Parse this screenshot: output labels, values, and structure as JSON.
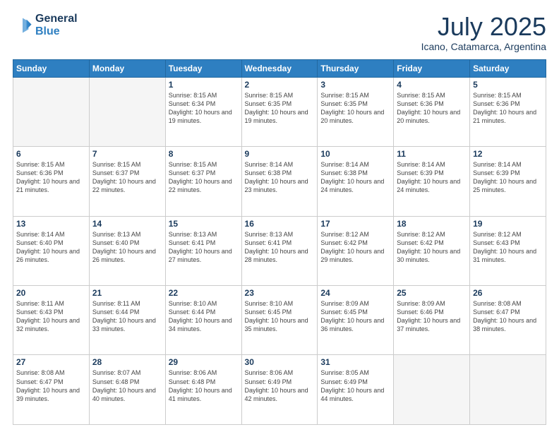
{
  "header": {
    "logo_line1": "General",
    "logo_line2": "Blue",
    "month_title": "July 2025",
    "location": "Icano, Catamarca, Argentina"
  },
  "days_of_week": [
    "Sunday",
    "Monday",
    "Tuesday",
    "Wednesday",
    "Thursday",
    "Friday",
    "Saturday"
  ],
  "weeks": [
    [
      {
        "day": "",
        "info": ""
      },
      {
        "day": "",
        "info": ""
      },
      {
        "day": "1",
        "info": "Sunrise: 8:15 AM\nSunset: 6:34 PM\nDaylight: 10 hours and 19 minutes."
      },
      {
        "day": "2",
        "info": "Sunrise: 8:15 AM\nSunset: 6:35 PM\nDaylight: 10 hours and 19 minutes."
      },
      {
        "day": "3",
        "info": "Sunrise: 8:15 AM\nSunset: 6:35 PM\nDaylight: 10 hours and 20 minutes."
      },
      {
        "day": "4",
        "info": "Sunrise: 8:15 AM\nSunset: 6:36 PM\nDaylight: 10 hours and 20 minutes."
      },
      {
        "day": "5",
        "info": "Sunrise: 8:15 AM\nSunset: 6:36 PM\nDaylight: 10 hours and 21 minutes."
      }
    ],
    [
      {
        "day": "6",
        "info": "Sunrise: 8:15 AM\nSunset: 6:36 PM\nDaylight: 10 hours and 21 minutes."
      },
      {
        "day": "7",
        "info": "Sunrise: 8:15 AM\nSunset: 6:37 PM\nDaylight: 10 hours and 22 minutes."
      },
      {
        "day": "8",
        "info": "Sunrise: 8:15 AM\nSunset: 6:37 PM\nDaylight: 10 hours and 22 minutes."
      },
      {
        "day": "9",
        "info": "Sunrise: 8:14 AM\nSunset: 6:38 PM\nDaylight: 10 hours and 23 minutes."
      },
      {
        "day": "10",
        "info": "Sunrise: 8:14 AM\nSunset: 6:38 PM\nDaylight: 10 hours and 24 minutes."
      },
      {
        "day": "11",
        "info": "Sunrise: 8:14 AM\nSunset: 6:39 PM\nDaylight: 10 hours and 24 minutes."
      },
      {
        "day": "12",
        "info": "Sunrise: 8:14 AM\nSunset: 6:39 PM\nDaylight: 10 hours and 25 minutes."
      }
    ],
    [
      {
        "day": "13",
        "info": "Sunrise: 8:14 AM\nSunset: 6:40 PM\nDaylight: 10 hours and 26 minutes."
      },
      {
        "day": "14",
        "info": "Sunrise: 8:13 AM\nSunset: 6:40 PM\nDaylight: 10 hours and 26 minutes."
      },
      {
        "day": "15",
        "info": "Sunrise: 8:13 AM\nSunset: 6:41 PM\nDaylight: 10 hours and 27 minutes."
      },
      {
        "day": "16",
        "info": "Sunrise: 8:13 AM\nSunset: 6:41 PM\nDaylight: 10 hours and 28 minutes."
      },
      {
        "day": "17",
        "info": "Sunrise: 8:12 AM\nSunset: 6:42 PM\nDaylight: 10 hours and 29 minutes."
      },
      {
        "day": "18",
        "info": "Sunrise: 8:12 AM\nSunset: 6:42 PM\nDaylight: 10 hours and 30 minutes."
      },
      {
        "day": "19",
        "info": "Sunrise: 8:12 AM\nSunset: 6:43 PM\nDaylight: 10 hours and 31 minutes."
      }
    ],
    [
      {
        "day": "20",
        "info": "Sunrise: 8:11 AM\nSunset: 6:43 PM\nDaylight: 10 hours and 32 minutes."
      },
      {
        "day": "21",
        "info": "Sunrise: 8:11 AM\nSunset: 6:44 PM\nDaylight: 10 hours and 33 minutes."
      },
      {
        "day": "22",
        "info": "Sunrise: 8:10 AM\nSunset: 6:44 PM\nDaylight: 10 hours and 34 minutes."
      },
      {
        "day": "23",
        "info": "Sunrise: 8:10 AM\nSunset: 6:45 PM\nDaylight: 10 hours and 35 minutes."
      },
      {
        "day": "24",
        "info": "Sunrise: 8:09 AM\nSunset: 6:45 PM\nDaylight: 10 hours and 36 minutes."
      },
      {
        "day": "25",
        "info": "Sunrise: 8:09 AM\nSunset: 6:46 PM\nDaylight: 10 hours and 37 minutes."
      },
      {
        "day": "26",
        "info": "Sunrise: 8:08 AM\nSunset: 6:47 PM\nDaylight: 10 hours and 38 minutes."
      }
    ],
    [
      {
        "day": "27",
        "info": "Sunrise: 8:08 AM\nSunset: 6:47 PM\nDaylight: 10 hours and 39 minutes."
      },
      {
        "day": "28",
        "info": "Sunrise: 8:07 AM\nSunset: 6:48 PM\nDaylight: 10 hours and 40 minutes."
      },
      {
        "day": "29",
        "info": "Sunrise: 8:06 AM\nSunset: 6:48 PM\nDaylight: 10 hours and 41 minutes."
      },
      {
        "day": "30",
        "info": "Sunrise: 8:06 AM\nSunset: 6:49 PM\nDaylight: 10 hours and 42 minutes."
      },
      {
        "day": "31",
        "info": "Sunrise: 8:05 AM\nSunset: 6:49 PM\nDaylight: 10 hours and 44 minutes."
      },
      {
        "day": "",
        "info": ""
      },
      {
        "day": "",
        "info": ""
      }
    ]
  ]
}
